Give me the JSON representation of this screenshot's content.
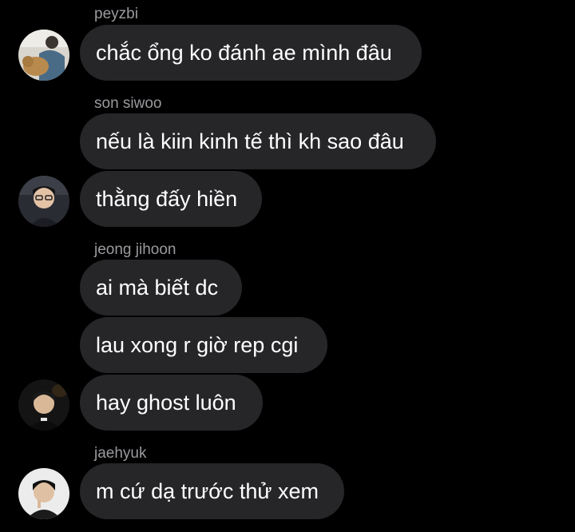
{
  "chat": {
    "groups": [
      {
        "sender": "peyzbi",
        "avatar_icon": "user-avatar-peyzbi",
        "messages": [
          "chắc ổng ko đánh ae mình đâu"
        ]
      },
      {
        "sender": "son siwoo",
        "avatar_icon": "user-avatar-son-siwoo",
        "messages": [
          "nếu là kiin kinh tế thì kh sao đâu",
          "thằng đấy hiền"
        ]
      },
      {
        "sender": "jeong jihoon",
        "avatar_icon": "user-avatar-jeong-jihoon",
        "messages": [
          "ai mà biết dc",
          "lau xong r giờ rep cgi",
          "hay ghost luôn"
        ]
      },
      {
        "sender": "jaehyuk",
        "avatar_icon": "user-avatar-jaehyuk",
        "messages": [
          "m cứ dạ trước thử xem"
        ]
      }
    ]
  },
  "colors": {
    "background": "#000000",
    "bubble": "#262629",
    "sender_text": "#9a9a9f",
    "message_text": "#ffffff"
  }
}
